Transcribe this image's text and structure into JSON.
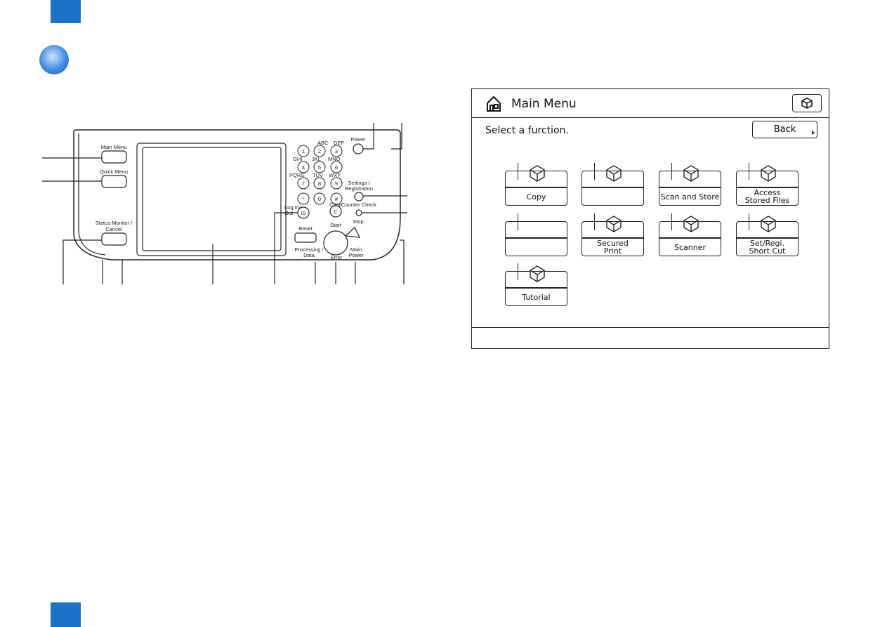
{
  "panel": {
    "labels": {
      "main_menu": "Main Menu",
      "quick_menu": "Quick Menu",
      "status_monitor": "Status Monitor /",
      "status_monitor2": "Cancel",
      "power": "Power",
      "settings": "Settings /",
      "settings2": "Registration",
      "counter_check": "Counter Check",
      "log_in": "Log In/",
      "log_out": "Out",
      "clear": "Clear",
      "reset": "Reset",
      "start": "Start",
      "stop": "Stop",
      "processing": "Processing /",
      "processing2": "Data",
      "error": "Error",
      "main_power": "Main",
      "main_power2": "Power"
    },
    "keys": [
      "1",
      "2",
      "3",
      "4",
      "5",
      "6",
      "7",
      "8",
      "9",
      "*",
      "0",
      "#"
    ],
    "key_letters": [
      "ABC",
      "DEF",
      "GHI",
      "JKL",
      "MNO",
      "PQRS",
      "TUV",
      "WXY"
    ]
  },
  "main_menu": {
    "title": "Main Menu",
    "prompt": "Select a furction.",
    "back_label": "Back",
    "tiles": [
      {
        "label": "Copy",
        "icon": "copy-icon"
      },
      {
        "label": "",
        "icon": "send-icon"
      },
      {
        "label": "Scan and Store",
        "icon": "scan-store-icon"
      },
      {
        "label": "Access\nStored Files",
        "icon": "stored-files-icon"
      },
      {
        "label": "",
        "icon": ""
      },
      {
        "label": "Secured\nPrint",
        "icon": "secured-print-icon"
      },
      {
        "label": "Scanner",
        "icon": "scanner-icon"
      },
      {
        "label": "Set/Regi.\nShort Cut",
        "icon": "shortcut-icon"
      },
      {
        "label": "Tutorial",
        "icon": "signpost-icon"
      }
    ]
  },
  "colors": {
    "accent": "#1a73c8"
  }
}
